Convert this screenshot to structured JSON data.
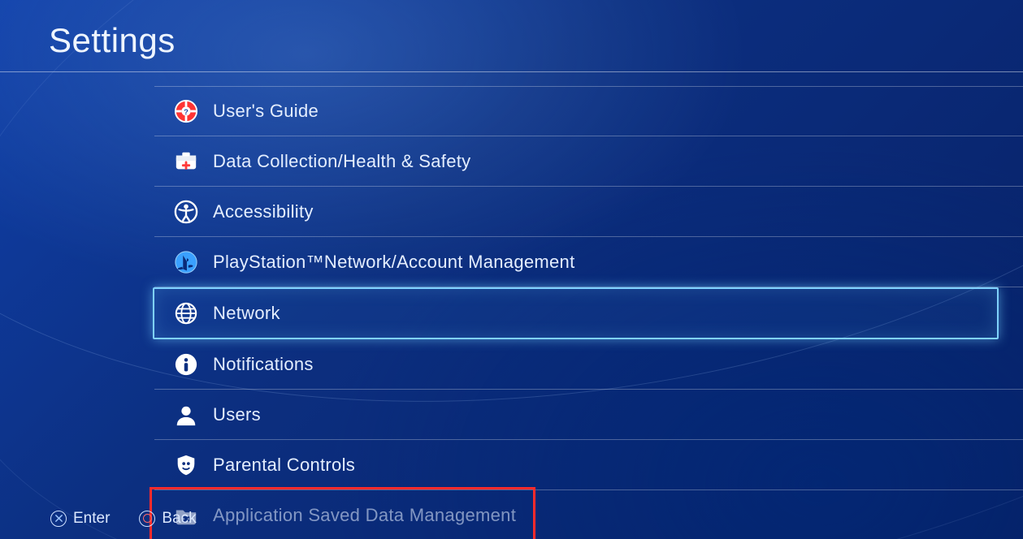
{
  "header": {
    "title": "Settings"
  },
  "menu": {
    "items": [
      {
        "id": "users-guide",
        "label": "User's Guide",
        "icon": "lifebuoy-icon"
      },
      {
        "id": "data-collection",
        "label": "Data Collection/Health & Safety",
        "icon": "medkit-icon"
      },
      {
        "id": "accessibility",
        "label": "Accessibility",
        "icon": "accessibility-icon"
      },
      {
        "id": "psn-account",
        "label": "PlayStation™Network/Account Management",
        "icon": "psn-logo-icon"
      },
      {
        "id": "network",
        "label": "Network",
        "icon": "globe-icon",
        "selected": true
      },
      {
        "id": "notifications",
        "label": "Notifications",
        "icon": "info-icon"
      },
      {
        "id": "users",
        "label": "Users",
        "icon": "user-icon"
      },
      {
        "id": "parental-controls",
        "label": "Parental Controls",
        "icon": "parental-icon"
      },
      {
        "id": "app-saved-data",
        "label": "Application Saved Data Management",
        "icon": "folder-controller-icon",
        "faded": true,
        "redbox": true
      }
    ]
  },
  "footer": {
    "enter_label": "Enter",
    "back_label": "Back"
  }
}
